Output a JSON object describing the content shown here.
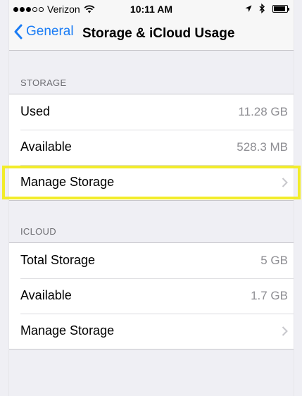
{
  "status_bar": {
    "carrier": "Verizon",
    "time": "10:11 AM",
    "signal_bars_filled": 3,
    "signal_bars_total": 5,
    "battery_level": 0.9,
    "icons": [
      "wifi-icon",
      "location-arrow-icon",
      "bluetooth-icon",
      "battery-icon"
    ]
  },
  "nav": {
    "back_label": "General",
    "title": "Storage & iCloud Usage"
  },
  "storage": {
    "header": "STORAGE",
    "used_label": "Used",
    "used_value": "11.28 GB",
    "available_label": "Available",
    "available_value": "528.3 MB",
    "manage_label": "Manage Storage"
  },
  "icloud": {
    "header": "ICLOUD",
    "total_label": "Total Storage",
    "total_value": "5 GB",
    "available_label": "Available",
    "available_value": "1.7 GB",
    "manage_label": "Manage Storage"
  },
  "colors": {
    "tint": "#1a7cf5",
    "highlight": "#f2ec2a",
    "background": "#efeff4"
  }
}
